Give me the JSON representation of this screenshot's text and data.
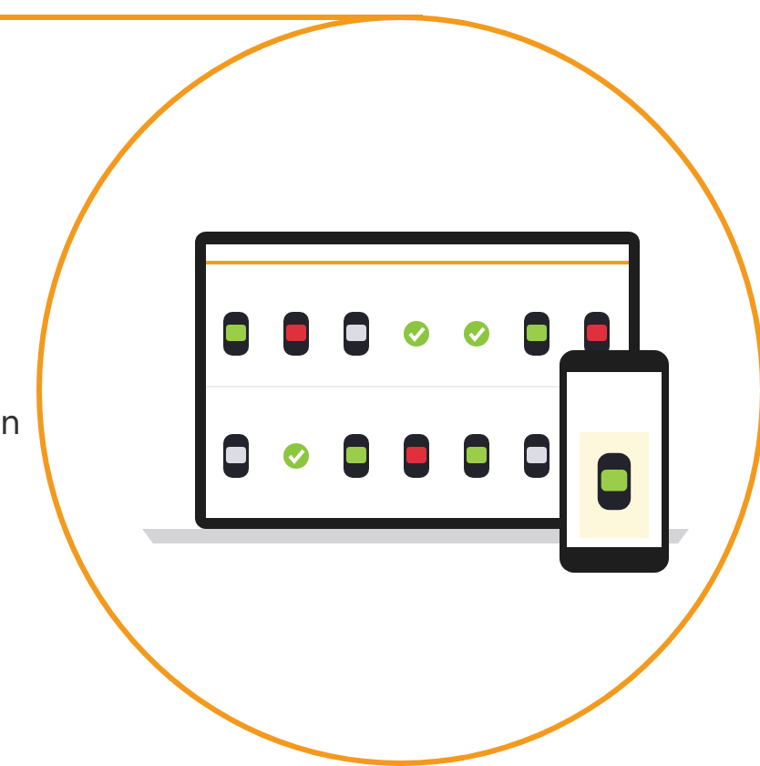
{
  "side_text": "n",
  "laptop_tiles": [
    {
      "kind": "car",
      "color": "#9acd4a"
    },
    {
      "kind": "car",
      "color": "#e0303c"
    },
    {
      "kind": "car",
      "color": "#dcdce4"
    },
    {
      "kind": "check"
    },
    {
      "kind": "check"
    },
    {
      "kind": "car",
      "color": "#9acd4a"
    },
    {
      "kind": "car",
      "color": "#e0303c"
    },
    {
      "kind": "car",
      "color": "#dcdce4"
    },
    {
      "kind": "check"
    },
    {
      "kind": "car",
      "color": "#9acd4a"
    },
    {
      "kind": "car",
      "color": "#e0303c"
    },
    {
      "kind": "car",
      "color": "#9acd4a"
    },
    {
      "kind": "car",
      "color": "#dcdce4"
    }
  ],
  "phone_tile": {
    "kind": "car",
    "color": "#9acd4a"
  }
}
